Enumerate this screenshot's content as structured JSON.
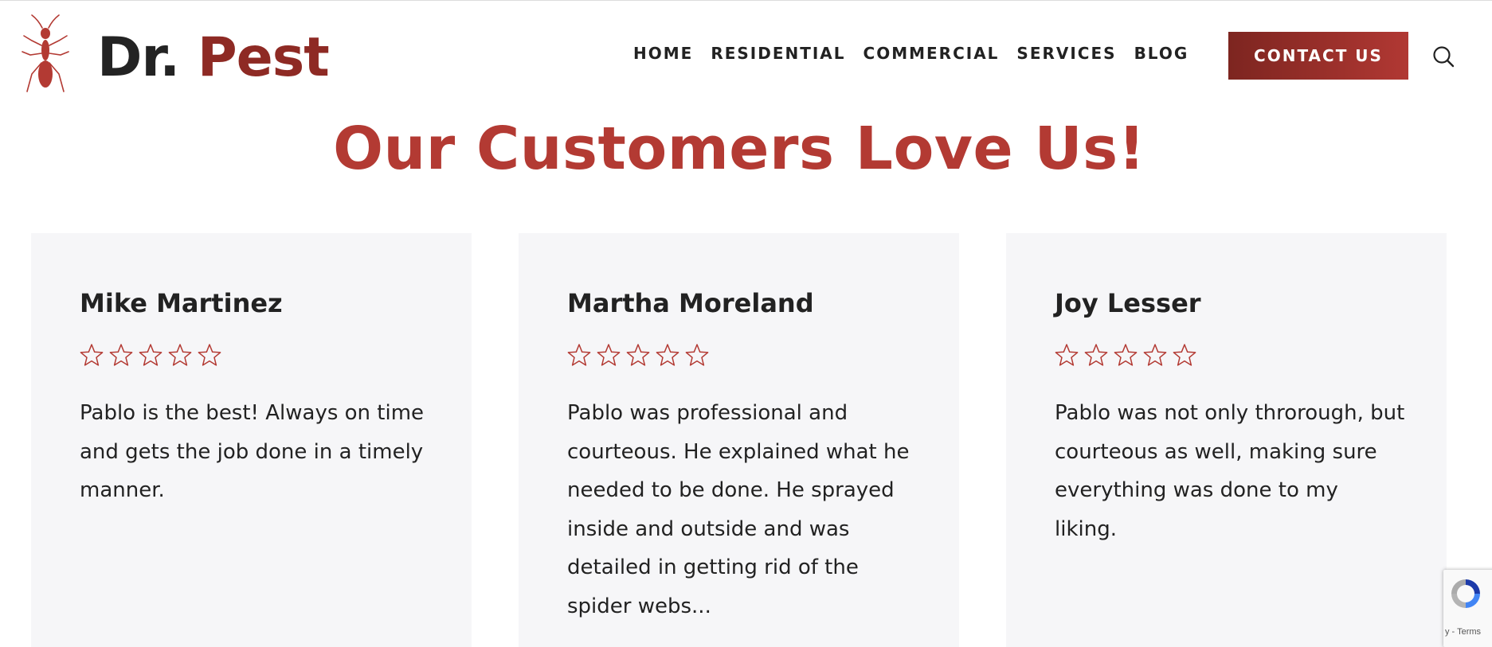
{
  "brand": {
    "part1": "Dr.",
    "part2": "Pest",
    "logo_icon": "ant-icon"
  },
  "nav": {
    "items": [
      {
        "label": "HOME"
      },
      {
        "label": "RESIDENTIAL"
      },
      {
        "label": "COMMERCIAL"
      },
      {
        "label": "SERVICES"
      },
      {
        "label": "BLOG"
      }
    ],
    "contact_label": "CONTACT US",
    "search_icon": "search-icon"
  },
  "heading": "Our Customers Love Us!",
  "testimonials": [
    {
      "name": "Mike Martinez",
      "rating": 5,
      "text": "Pablo is the best! Always on time and gets the job done in a timely manner."
    },
    {
      "name": "Martha Moreland",
      "rating": 5,
      "text": "Pablo was professional and courteous. He explained what he needed to be done. He sprayed inside and outside and was detailed in getting rid of the spider webs..."
    },
    {
      "name": "Joy Lesser",
      "rating": 5,
      "text": "Pablo was not only throrough, but courteous as well, making sure everything was done to my liking."
    }
  ],
  "recaptcha": {
    "text": "y - Terms"
  },
  "colors": {
    "accent": "#b33a33",
    "accent_dark": "#7d2520",
    "card_bg": "#f6f6f8",
    "text": "#222222"
  }
}
